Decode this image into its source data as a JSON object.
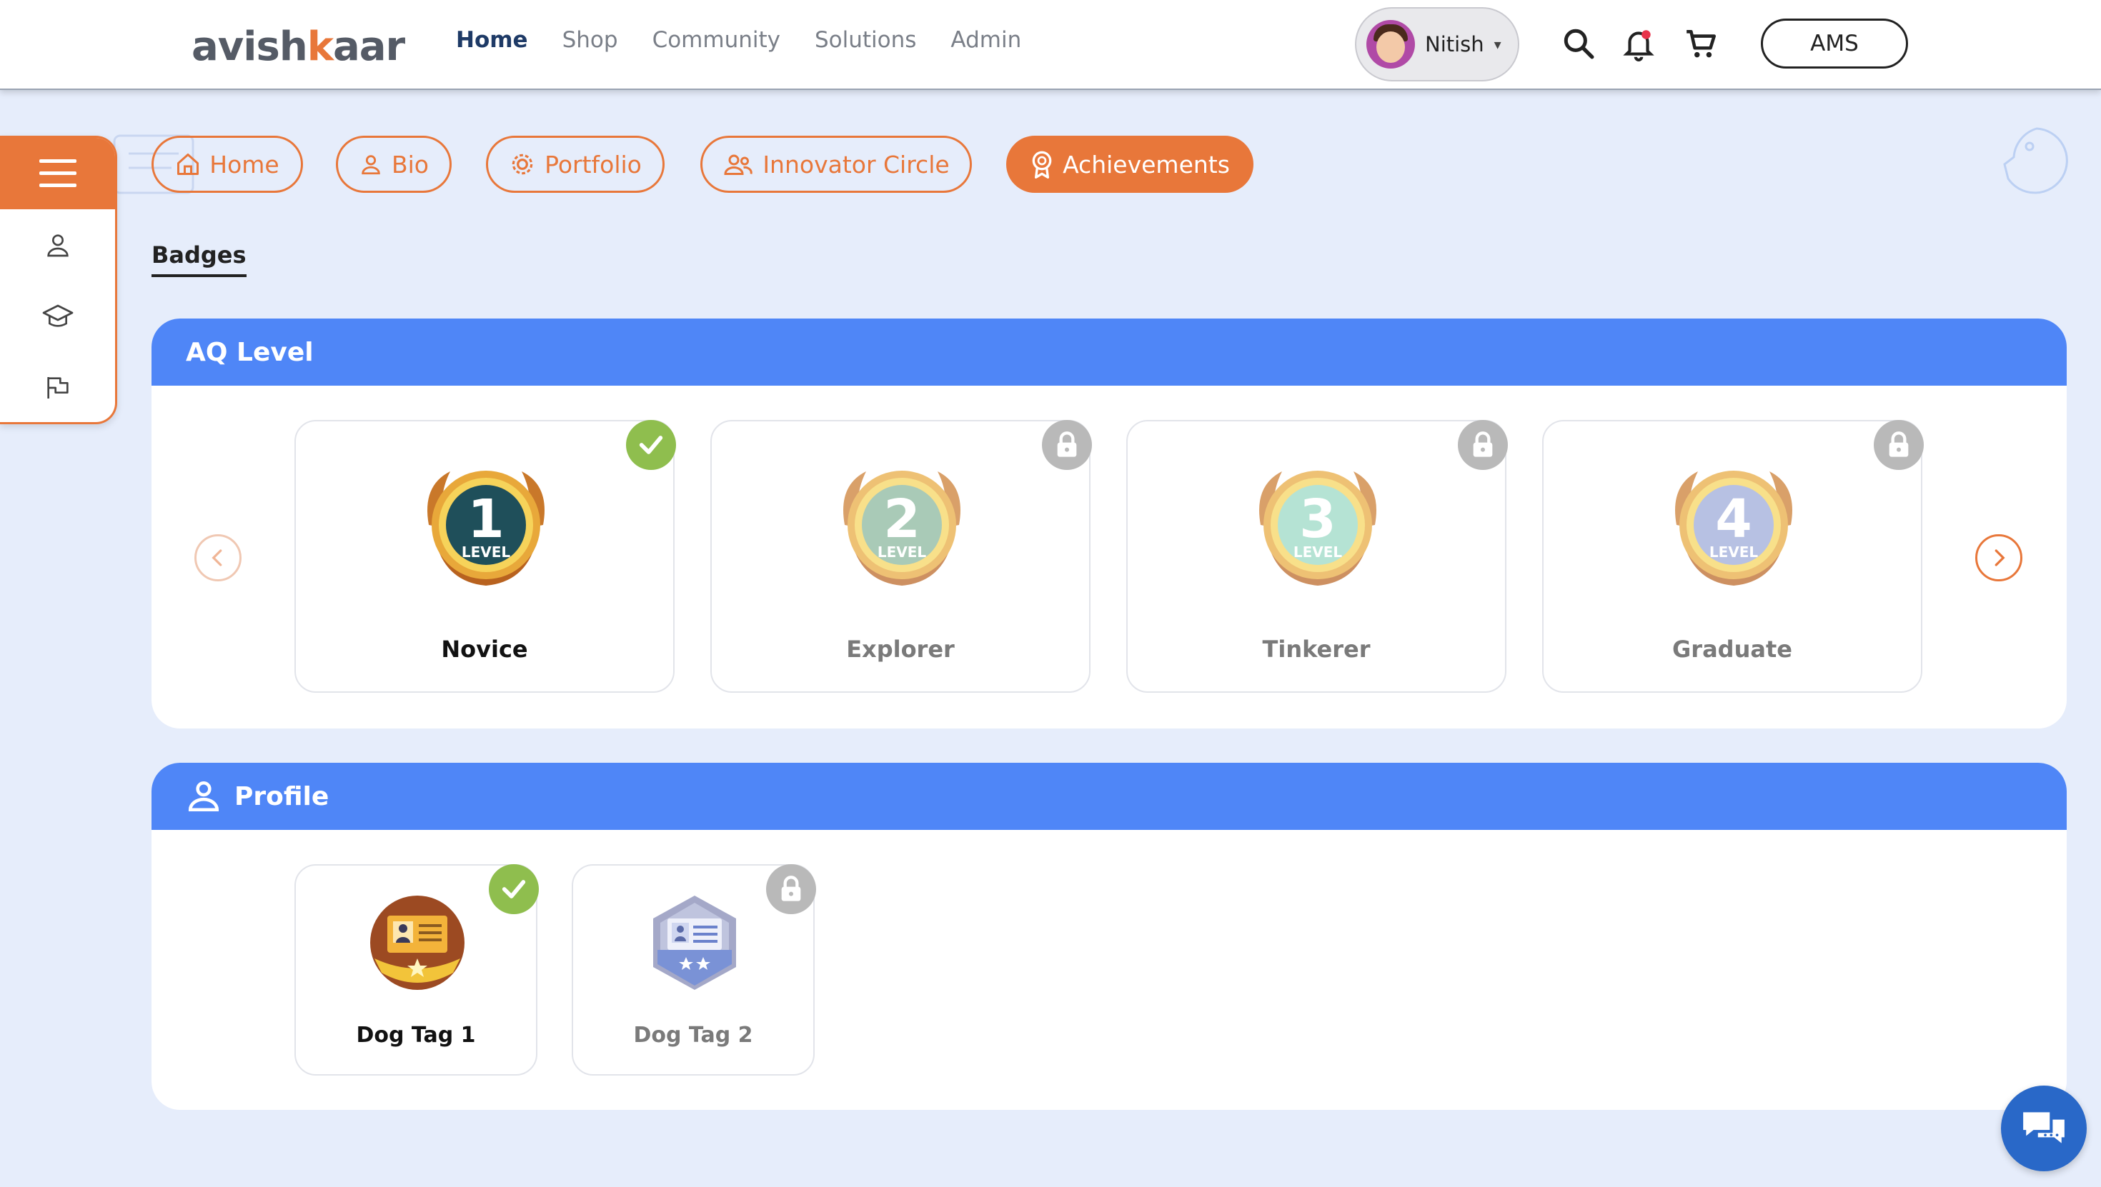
{
  "header": {
    "logo_prefix": "avish",
    "logo_k": "k",
    "logo_suffix": "aar",
    "nav": [
      {
        "label": "Home",
        "active": true
      },
      {
        "label": "Shop"
      },
      {
        "label": "Community"
      },
      {
        "label": "Solutions"
      },
      {
        "label": "Admin"
      }
    ],
    "user": {
      "name": "Nitish",
      "caret": "▾"
    },
    "ams_label": "AMS"
  },
  "tabs": [
    {
      "label": "Home",
      "icon": "home-icon"
    },
    {
      "label": "Bio",
      "icon": "person-icon"
    },
    {
      "label": "Portfolio",
      "icon": "gear-bulb-icon"
    },
    {
      "label": "Innovator Circle",
      "icon": "group-icon"
    },
    {
      "label": "Achievements",
      "icon": "award-icon",
      "active": true
    }
  ],
  "section_title": "Badges",
  "aq_level": {
    "title": "AQ Level",
    "badges": [
      {
        "number": "1",
        "level_text": "LEVEL",
        "name": "Novice",
        "status": "unlocked",
        "core_color": "#1f4f5a"
      },
      {
        "number": "2",
        "level_text": "LEVEL",
        "name": "Explorer",
        "status": "locked",
        "core_color": "#86b59a"
      },
      {
        "number": "3",
        "level_text": "LEVEL",
        "name": "Tinkerer",
        "status": "locked",
        "core_color": "#96d8c2"
      },
      {
        "number": "4",
        "level_text": "LEVEL",
        "name": "Graduate",
        "status": "locked",
        "core_color": "#9aa8d8"
      }
    ]
  },
  "profile": {
    "title": "Profile",
    "badges": [
      {
        "name": "Dog Tag 1",
        "status": "unlocked"
      },
      {
        "name": "Dog Tag 2",
        "status": "locked"
      }
    ]
  },
  "colors": {
    "accent": "#e8773a",
    "panel_header": "#4f86f7",
    "unlocked": "#8fbe4e",
    "locked": "#b9b9b9",
    "chat": "#2968c8"
  }
}
